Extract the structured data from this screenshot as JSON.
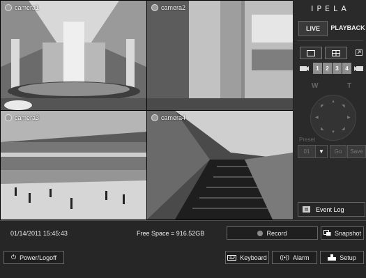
{
  "brand": {
    "logo": "IPELA"
  },
  "cameras": [
    {
      "label": "camera1"
    },
    {
      "label": "camera2"
    },
    {
      "label": "camera3"
    },
    {
      "label": "camera4"
    }
  ],
  "panel": {
    "live_label": "LIVE",
    "playback_label": "PLAYBACK",
    "channels": [
      "1",
      "2",
      "3",
      "4"
    ],
    "zoom_wide": "W",
    "zoom_tele": "T",
    "preset_label": "Preset",
    "preset_value": "01",
    "go_label": "Go",
    "save_label": "Save",
    "event_log_label": "Event Log",
    "icons": {
      "single_layout": "single-view-icon",
      "quad_layout": "quad-view-icon",
      "fullscreen": "fullscreen-icon",
      "camera_prev": "camera-switch-icon",
      "camera_next": "camera-switch-icon",
      "event_log": "event-log-icon"
    }
  },
  "status": {
    "datetime": "01/14/2011 15:45:43",
    "free_space": "Free Space  = 916.52GB"
  },
  "actions": {
    "record_label": "Record",
    "snapshot_label": "Snapshot",
    "power_label": "Power/Logoff",
    "keyboard_label": "Keyboard",
    "alarm_label": "Alarm",
    "setup_label": "Setup"
  },
  "colors": {
    "accent_dark": "#262626",
    "record_dot": "#8a8a8a",
    "channel_button": "#8e8e8e"
  }
}
